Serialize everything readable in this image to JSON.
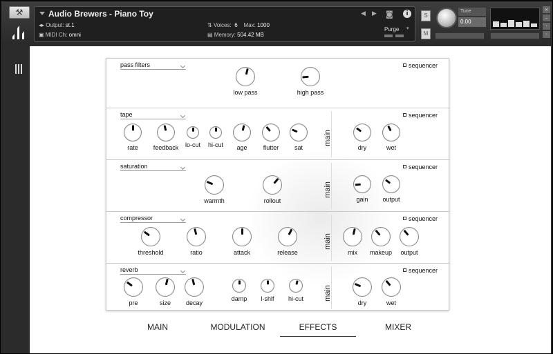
{
  "header": {
    "instrument_name": "Audio Brewers - Piano Toy",
    "output_label": "Output:",
    "output_value": "st.1",
    "midi_label": "MIDI Ch:",
    "midi_value": "omni",
    "voices_label": "Voices:",
    "voices_value": "6",
    "max_label": "Max:",
    "max_value": "1000",
    "memory_label": "Memory:",
    "memory_value": "504.42 MB",
    "purge_label": "Purge",
    "s_button": "S",
    "m_button": "M",
    "tune_label": "Tune",
    "tune_value": "0.00",
    "info_icon": "info-icon",
    "camera_icon": "camera-icon"
  },
  "sections": [
    {
      "title": "pass filters",
      "sequencer": "sequencer",
      "knobs": [
        {
          "label": "low pass",
          "value": 0.55
        },
        {
          "label": "high pass",
          "value": 0.15
        }
      ]
    },
    {
      "title": "tape",
      "sequencer": "sequencer",
      "main_label": "main",
      "knobs": [
        {
          "label": "rate",
          "value": 0.5
        },
        {
          "label": "feedback",
          "value": 0.45
        },
        {
          "label": "lo-cut",
          "value": 0.5
        },
        {
          "label": "hi-cut",
          "value": 0.5
        },
        {
          "label": "age",
          "value": 0.55
        },
        {
          "label": "flutter",
          "value": 0.35
        },
        {
          "label": "sat",
          "value": 0.25
        }
      ],
      "side_knobs": [
        {
          "label": "dry",
          "value": 0.3
        },
        {
          "label": "wet",
          "value": 0.4
        }
      ]
    },
    {
      "title": "saturation",
      "sequencer": "sequencer",
      "main_label": "main",
      "knobs": [
        {
          "label": "warmth",
          "value": 0.25
        },
        {
          "label": "rollout",
          "value": 0.65
        }
      ],
      "side_knobs": [
        {
          "label": "gain",
          "value": 0.15
        },
        {
          "label": "output",
          "value": 0.3
        }
      ]
    },
    {
      "title": "compressor",
      "sequencer": "sequencer",
      "main_label": "main",
      "knobs": [
        {
          "label": "threshold",
          "value": 0.3
        },
        {
          "label": "ratio",
          "value": 0.45
        },
        {
          "label": "attack",
          "value": 0.5
        },
        {
          "label": "release",
          "value": 0.6
        }
      ],
      "side_knobs": [
        {
          "label": "mix",
          "value": 0.55
        },
        {
          "label": "makeup",
          "value": 0.35
        },
        {
          "label": "output",
          "value": 0.35
        }
      ]
    },
    {
      "title": "reverb",
      "sequencer": "sequencer",
      "main_label": "main",
      "knobs": [
        {
          "label": "pre",
          "value": 0.3
        },
        {
          "label": "size",
          "value": 0.55
        },
        {
          "label": "decay",
          "value": 0.45
        },
        {
          "label": "damp",
          "value": 0.5
        },
        {
          "label": "l-shlf",
          "value": 0.5
        },
        {
          "label": "hi-cut",
          "value": 0.55
        }
      ],
      "side_knobs": [
        {
          "label": "dry",
          "value": 0.25
        },
        {
          "label": "wet",
          "value": 0.35
        }
      ]
    }
  ],
  "tabs": [
    {
      "label": "MAIN",
      "active": false
    },
    {
      "label": "MODULATION",
      "active": false
    },
    {
      "label": "EFFECTS",
      "active": true
    },
    {
      "label": "MIXER",
      "active": false
    }
  ]
}
